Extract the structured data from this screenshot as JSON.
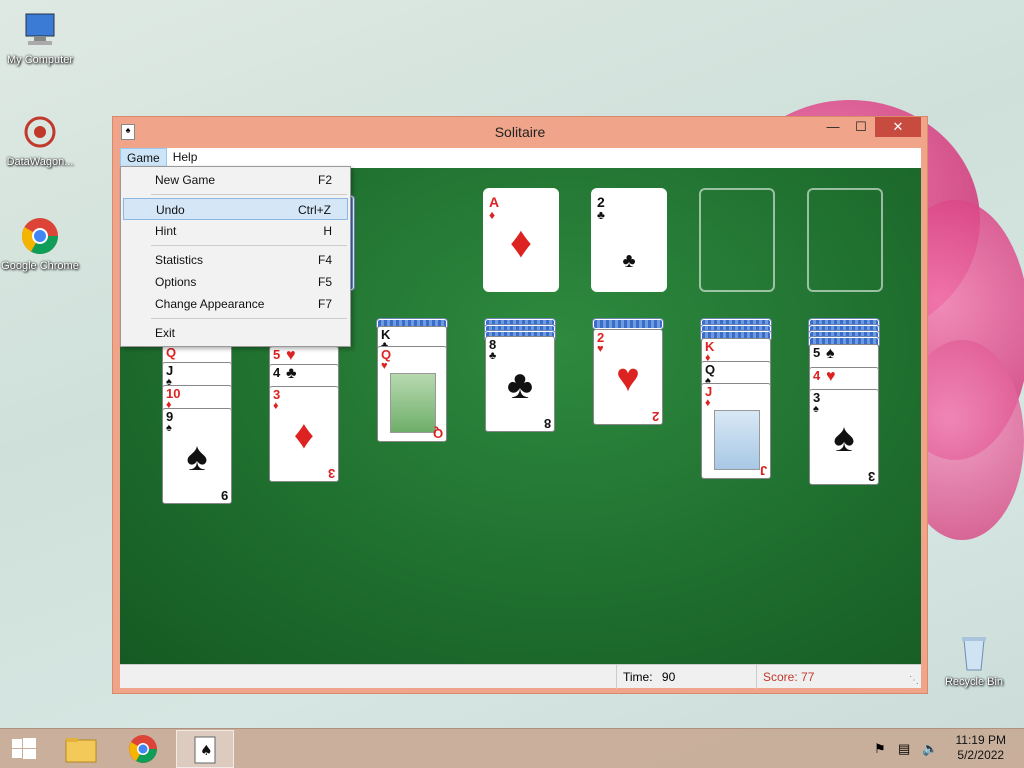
{
  "desktop": {
    "icons": [
      {
        "label": "My Computer",
        "icon": "computer-icon"
      },
      {
        "label": "DataWagon...",
        "icon": "datawagon-icon"
      },
      {
        "label": "Google Chrome",
        "icon": "chrome-icon"
      },
      {
        "label": "Recycle Bin",
        "icon": "recycle-bin-icon"
      }
    ]
  },
  "window": {
    "title": "Solitaire",
    "controls": {
      "minimize": "—",
      "maximize": "☐",
      "close": "✕"
    }
  },
  "menubar": {
    "items": [
      {
        "label": "Game"
      },
      {
        "label": "Help"
      }
    ]
  },
  "game_menu": {
    "items": [
      {
        "label": "New Game",
        "shortcut": "F2"
      },
      {
        "label": "Undo",
        "shortcut": "Ctrl+Z"
      },
      {
        "label": "Hint",
        "shortcut": "H"
      },
      {
        "label": "Statistics",
        "shortcut": "F4"
      },
      {
        "label": "Options",
        "shortcut": "F5"
      },
      {
        "label": "Change Appearance",
        "shortcut": "F7"
      },
      {
        "label": "Exit",
        "shortcut": ""
      }
    ]
  },
  "foundations": [
    {
      "rank": "A",
      "suit": "♦",
      "color": "red"
    },
    {
      "rank": "2",
      "suit": "♣",
      "color": "black"
    },
    {
      "rank": "",
      "suit": ""
    },
    {
      "rank": "",
      "suit": ""
    }
  ],
  "tableau": {
    "col1": [
      {
        "rank": "Q",
        "suit": "♦"
      },
      {
        "rank": "J",
        "suit": "♠"
      },
      {
        "rank": "10",
        "suit": "♦"
      },
      {
        "rank": "9",
        "suit": "♠"
      }
    ],
    "col2": [
      {
        "rank": "5",
        "suit": "♥"
      },
      {
        "rank": "4",
        "suit": "♣"
      },
      {
        "rank": "3",
        "suit": "♦"
      }
    ],
    "col3": [
      {
        "rank": "K",
        "suit": "♣"
      },
      {
        "rank": "Q",
        "suit": "♥"
      }
    ],
    "col4": [
      {
        "rank": "8",
        "suit": "♣"
      }
    ],
    "col5": [
      {
        "rank": "2",
        "suit": "♥"
      }
    ],
    "col6": [
      {
        "rank": "K",
        "suit": "♦"
      },
      {
        "rank": "Q",
        "suit": "♠"
      },
      {
        "rank": "J",
        "suit": "♦"
      }
    ],
    "col7": [
      {
        "rank": "5",
        "suit": "♠"
      },
      {
        "rank": "4",
        "suit": "♥"
      },
      {
        "rank": "3",
        "suit": "♠"
      }
    ]
  },
  "status": {
    "time_label": "Time:",
    "time_value": "90",
    "score_text": "Score: 77"
  },
  "taskbar": {
    "time": "11:19 PM",
    "date": "5/2/2022"
  },
  "colors": {
    "felt": "#1f6f2f",
    "titlebar": "#f0a58a",
    "close": "#c74b3f",
    "score": "#c0392b"
  }
}
